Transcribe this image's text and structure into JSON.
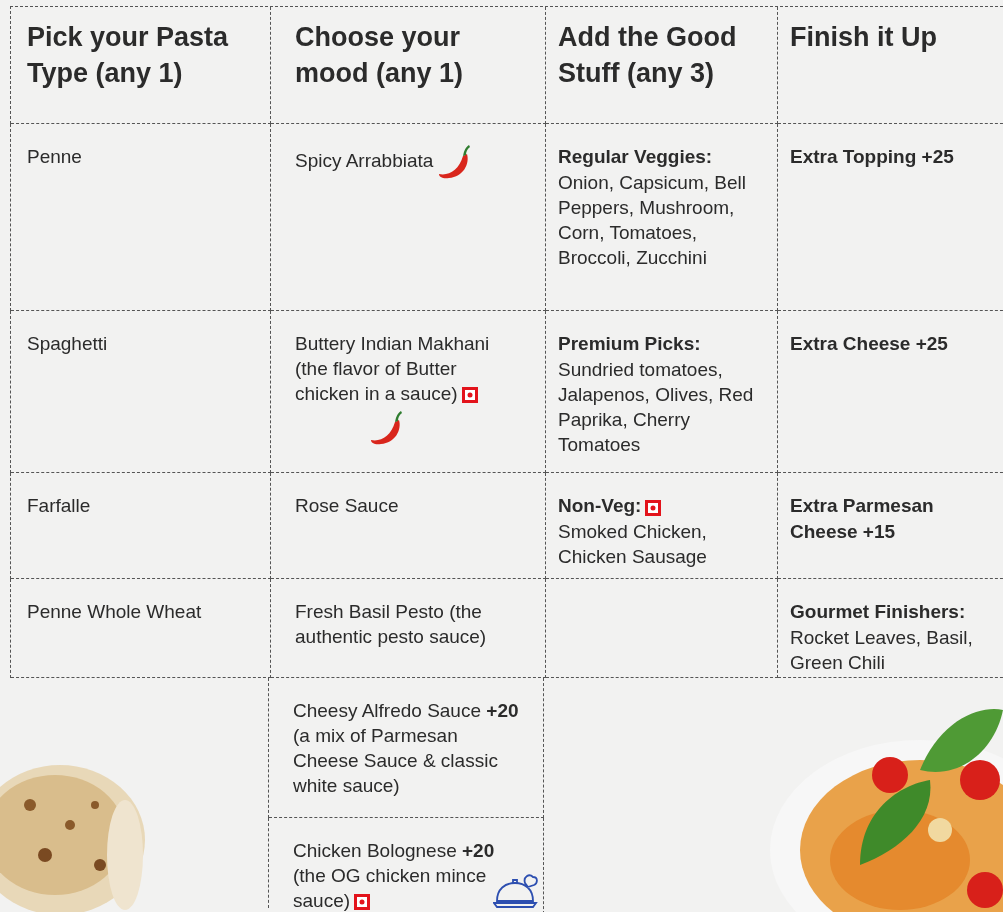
{
  "columns": [
    {
      "title": "Pick your Pasta Type (any 1)"
    },
    {
      "title": "Choose your mood (any 1)"
    },
    {
      "title": "Add the Good Stuff (any 3)"
    },
    {
      "title": "Finish it Up"
    }
  ],
  "rows": [
    [
      {
        "text": "Penne"
      },
      {
        "text": "Spicy Arrabbiata",
        "spicy": true,
        "non_veg": false
      },
      {
        "heading": "Regular Veggies:",
        "text": "Onion, Capsicum, Bell Peppers, Mushroom, Corn, Tomatoes, Broccoli, Zucchini",
        "non_veg": false
      },
      {
        "heading": "Extra Topping +25"
      }
    ],
    [
      {
        "text": "Spaghetti"
      },
      {
        "text": "Buttery Indian Makhani (the flavor of Butter chicken in a sauce)",
        "spicy": true,
        "non_veg": true
      },
      {
        "heading": "Premium Picks:",
        "text": "Sundried tomatoes, Jalapenos, Olives, Red Paprika, Cherry Tomatoes",
        "non_veg": false
      },
      {
        "heading": "Extra Cheese +25"
      }
    ],
    [
      {
        "text": "Farfalle"
      },
      {
        "text": "Rose Sauce",
        "spicy": false,
        "non_veg": false
      },
      {
        "heading": "Non-Veg:",
        "text": "Smoked Chicken, Chicken Sausage",
        "non_veg": true
      },
      {
        "heading": "Extra Parmesan Cheese +15"
      }
    ],
    [
      {
        "text": "Penne Whole Wheat"
      },
      {
        "text": "Fresh Basil Pesto (the authentic pesto sauce)",
        "spicy": false,
        "non_veg": false
      },
      null,
      {
        "heading": "Gourmet Finishers:",
        "text": "Rocket Leaves, Basil, Green Chili"
      }
    ]
  ],
  "more_moods": [
    {
      "text": "Cheesy Alfredo Sauce **+20** (a mix of Parmesan Cheese Sauce & classic white sauce)",
      "spicy": false,
      "non_veg": false
    },
    {
      "text": "Chicken Bolognese **+20** (the OG chicken mince sauce)",
      "spicy": false,
      "non_veg": true
    }
  ]
}
